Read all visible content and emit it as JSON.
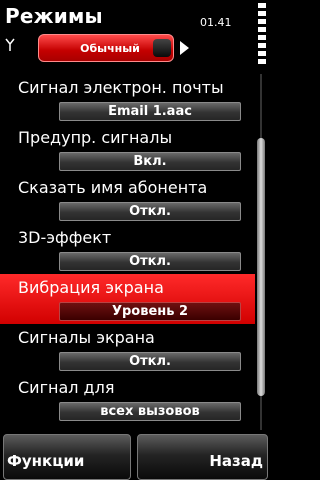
{
  "header": {
    "title": "Режимы",
    "time": "01.41",
    "profile": "Обычный",
    "signal_icon": "antenna-icon",
    "battery_icon": "battery-level-icon",
    "next_icon": "arrow-right-icon"
  },
  "settings": [
    {
      "label": "Сигнал электрон. почты",
      "value": "Email 1.aac"
    },
    {
      "label": "Предупр. сигналы",
      "value": "Вкл."
    },
    {
      "label": "Сказать имя абонента",
      "value": "Откл."
    },
    {
      "label": "3D-эффект",
      "value": "Откл."
    },
    {
      "label": "Вибрация экрана",
      "value": "Уровень 2",
      "selected": true
    },
    {
      "label": "Сигналы экрана",
      "value": "Откл."
    },
    {
      "label": "Сигнал для",
      "value": "всех вызовов"
    }
  ],
  "softkeys": {
    "left": "Функции",
    "right": "Назад"
  },
  "colors": {
    "highlight": "#e00000",
    "background": "#000000",
    "text": "#ffffff"
  }
}
